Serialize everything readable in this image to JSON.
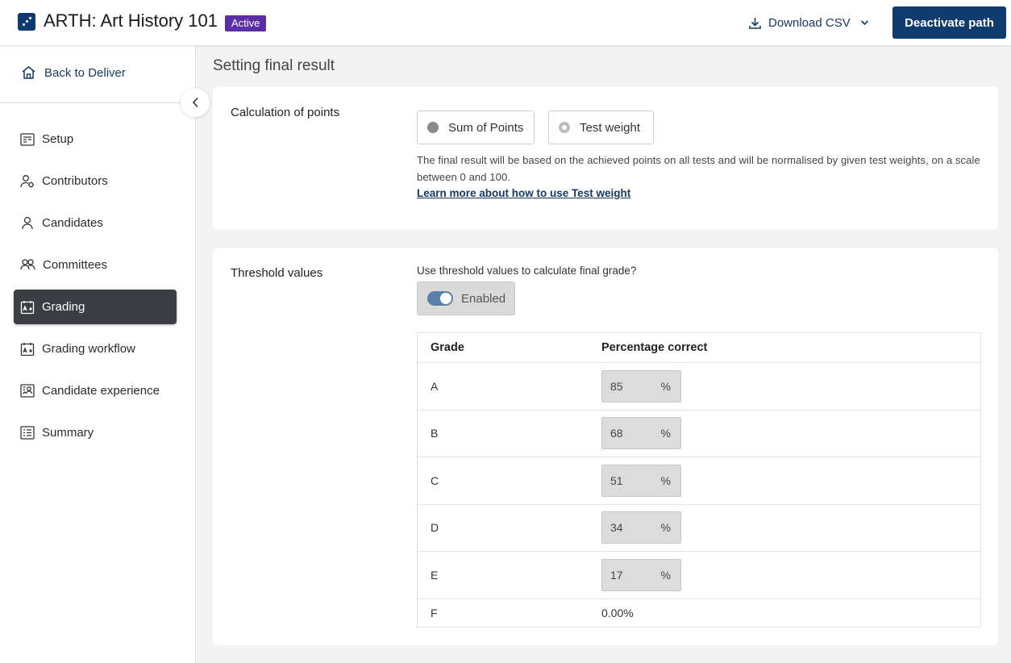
{
  "header": {
    "app_title": "ARTH: Art History 101",
    "status_badge": "Active",
    "download_label": "Download CSV",
    "deactivate_label": "Deactivate path"
  },
  "sidebar": {
    "back_label": "Back to Deliver",
    "items": [
      {
        "label": "Setup",
        "icon": "setup-icon"
      },
      {
        "label": "Contributors",
        "icon": "contributors-icon"
      },
      {
        "label": "Candidates",
        "icon": "person-icon"
      },
      {
        "label": "Committees",
        "icon": "people-icon"
      },
      {
        "label": "Grading",
        "icon": "grading-icon",
        "active": true
      },
      {
        "label": "Grading workflow",
        "icon": "grading-workflow-icon"
      },
      {
        "label": "Candidate experience",
        "icon": "candidate-experience-icon"
      },
      {
        "label": "Summary",
        "icon": "summary-icon"
      }
    ]
  },
  "main": {
    "page_title": "Setting final result",
    "calculation": {
      "label": "Calculation of points",
      "options": [
        "Sum of Points",
        "Test weight"
      ],
      "description": "The final result will be based on the achieved points on all tests and will be normalised by given test weights, on a scale between 0 and 100.",
      "learn_more": "Learn more about how to use Test weight"
    },
    "threshold": {
      "label": "Threshold values",
      "question": "Use threshold values to calculate final grade?",
      "toggle_label": "Enabled",
      "table": {
        "headers": [
          "Grade",
          "Percentage correct"
        ],
        "rows": [
          {
            "grade": "A",
            "value": "85",
            "unit": "%"
          },
          {
            "grade": "B",
            "value": "68",
            "unit": "%"
          },
          {
            "grade": "C",
            "value": "51",
            "unit": "%"
          },
          {
            "grade": "D",
            "value": "34",
            "unit": "%"
          },
          {
            "grade": "E",
            "value": "17",
            "unit": "%"
          }
        ],
        "last_row": {
          "grade": "F",
          "value": "0.00%"
        }
      }
    }
  },
  "colors": {
    "brand": "#0f3b6f",
    "badge": "#5b2ea6",
    "active_nav": "#3b3f44",
    "toggle": "#5a7fa8"
  }
}
